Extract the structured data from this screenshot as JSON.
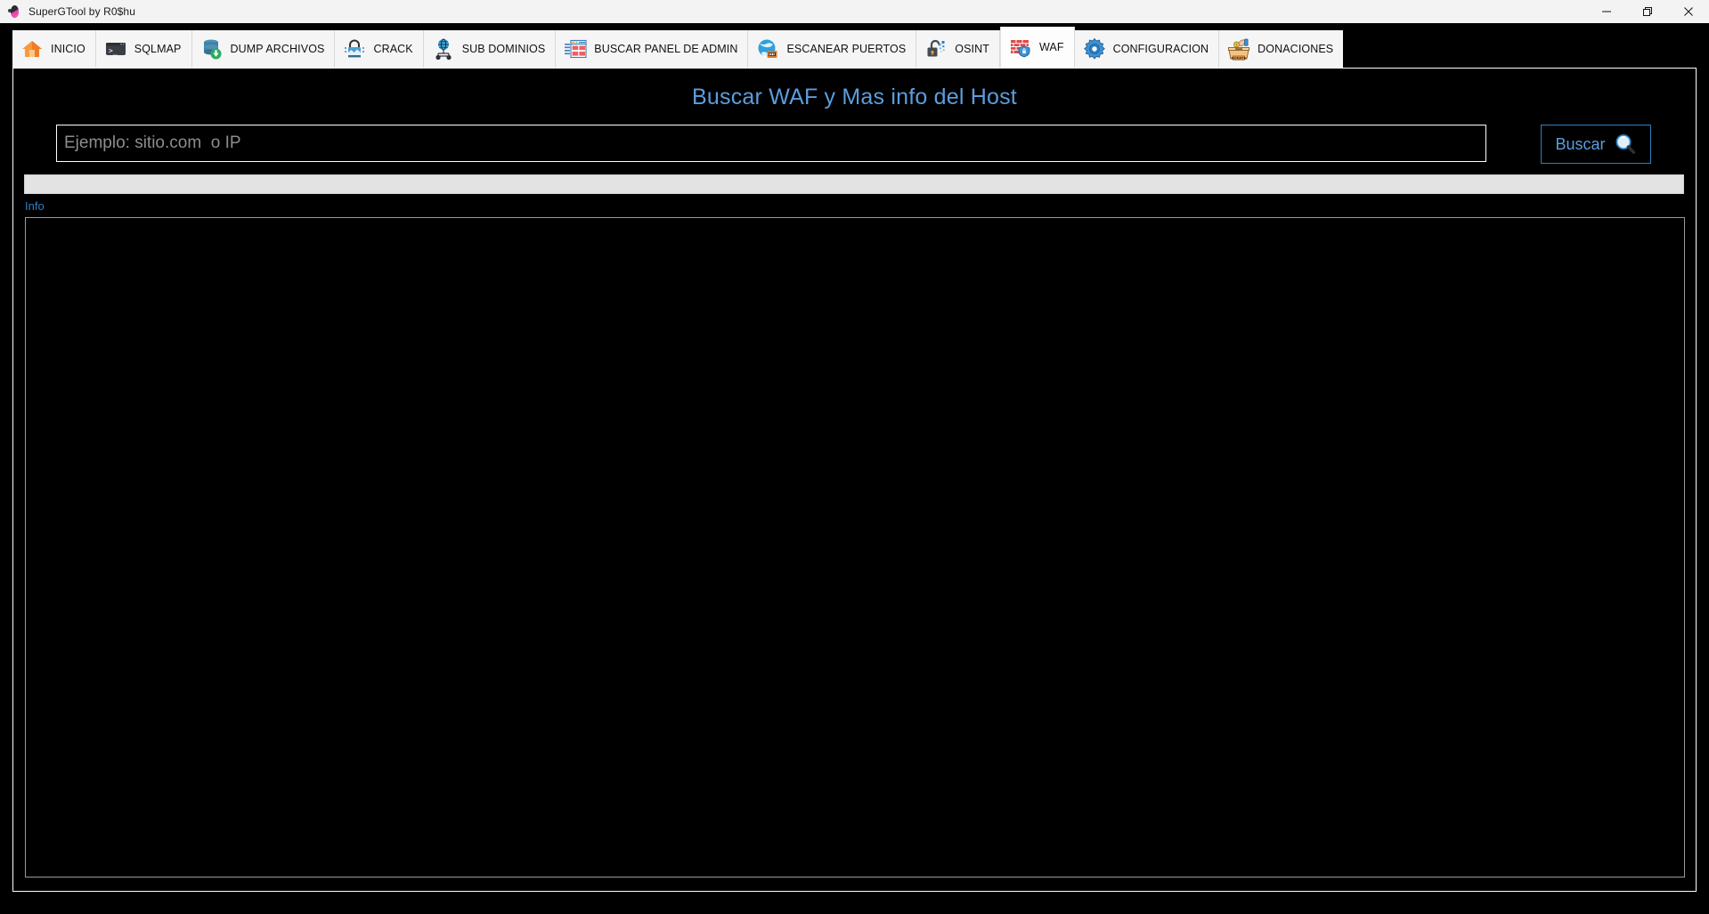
{
  "window": {
    "title": "SuperGTool by R0$hu",
    "icon": "bug-icon",
    "controls": [
      {
        "name": "minimize-button",
        "glyph": "minimize-icon"
      },
      {
        "name": "restore-button",
        "glyph": "restore-icon"
      },
      {
        "name": "close-button",
        "glyph": "close-icon"
      }
    ]
  },
  "toolbar": {
    "tabs": [
      {
        "label": "INICIO",
        "icon": "home-icon",
        "active": false
      },
      {
        "label": "SQLMAP",
        "icon": "terminal-icon",
        "active": false
      },
      {
        "label": "DUMP ARCHIVOS",
        "icon": "database-download-icon",
        "active": false
      },
      {
        "label": "CRACK",
        "icon": "padlock-crack-icon",
        "active": false
      },
      {
        "label": "SUB DOMINIOS",
        "icon": "globe-network-icon",
        "active": false
      },
      {
        "label": "BUSCAR PANEL DE ADMIN",
        "icon": "admin-panel-icon",
        "active": false
      },
      {
        "label": "ESCANEAR PUERTOS",
        "icon": "globe-server-icon",
        "active": false
      },
      {
        "label": "OSINT",
        "icon": "open-padlock-pixels-icon",
        "active": false
      },
      {
        "label": "WAF",
        "icon": "firewall-shield-icon",
        "active": true
      },
      {
        "label": "CONFIGURACION",
        "icon": "gear-icon",
        "active": false
      },
      {
        "label": "DONACIONES",
        "icon": "donation-box-icon",
        "active": false
      }
    ]
  },
  "main": {
    "page_title": "Buscar WAF y Mas info del Host",
    "search": {
      "placeholder": "Ejemplo: sitio.com  o IP",
      "value": "",
      "button_label": "Buscar",
      "button_icon": "magnifier-icon"
    },
    "progress": {
      "value": 0
    },
    "info": {
      "label": "Info",
      "content": ""
    }
  },
  "colors": {
    "accent_blue": "#5b9ede",
    "link_blue": "#2f7fc4",
    "background": "#000000",
    "titlebar": "#f3f3f3",
    "tab_background": "#f5f5f5",
    "tab_active_background": "#fdfdfd",
    "progress_track": "#e3e3e3",
    "panel_border": "#9a9a9a"
  }
}
